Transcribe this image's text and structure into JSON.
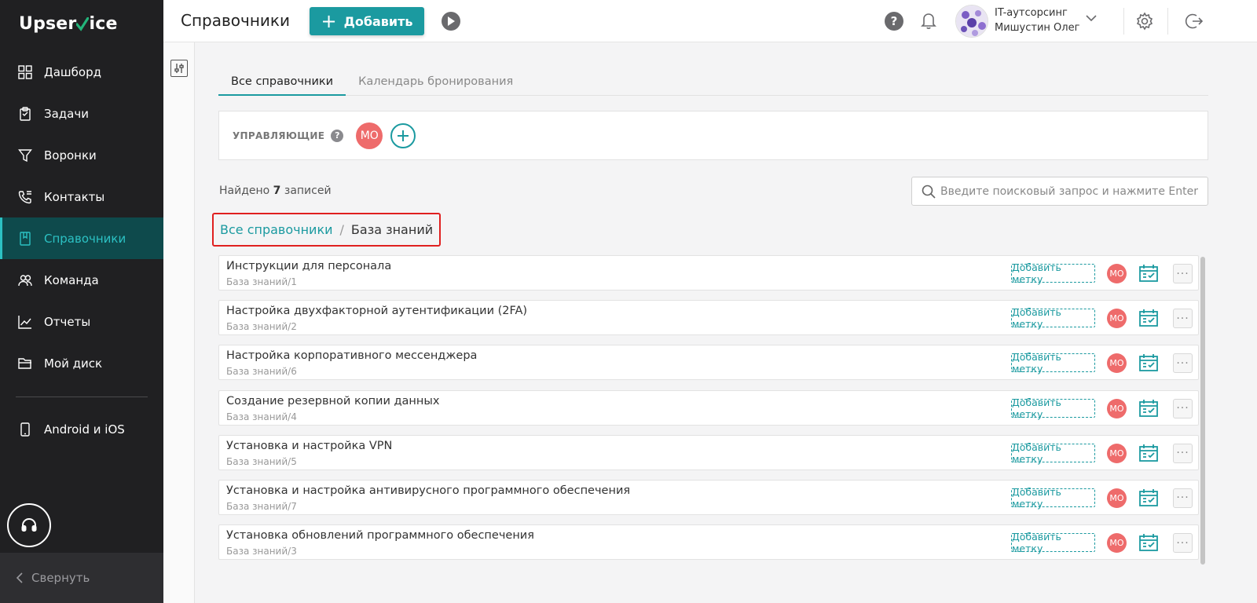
{
  "app": {
    "logo_text_a": "Upser",
    "logo_text_b": "ice",
    "accent_color": "#1b9aa0",
    "logo_check_color": "#23b47a"
  },
  "sidebar": {
    "items": [
      {
        "label": "Дашборд",
        "icon": "dashboard-grid-icon"
      },
      {
        "label": "Задачи",
        "icon": "tasks-clipboard-icon"
      },
      {
        "label": "Воронки",
        "icon": "funnel-icon"
      },
      {
        "label": "Контакты",
        "icon": "phone-contacts-icon"
      },
      {
        "label": "Справочники",
        "icon": "book-icon",
        "active": true
      },
      {
        "label": "Команда",
        "icon": "team-icon"
      },
      {
        "label": "Отчеты",
        "icon": "chart-line-icon"
      },
      {
        "label": "Мой диск",
        "icon": "folder-icon"
      }
    ],
    "android_ios": "Android и iOS",
    "collapse_label": "Свернуть"
  },
  "topbar": {
    "title": "Справочники",
    "add_label": "Добавить",
    "org_name": "IT-аутсорсинг",
    "user_name": "Мишустин Олег",
    "help_glyph": "?"
  },
  "tabs": [
    {
      "label": "Все справочники",
      "active": true
    },
    {
      "label": "Календарь бронирования",
      "active": false
    }
  ],
  "managers": {
    "label": "УПРАВЛЯЮЩИЕ",
    "avatar_initials": "МО",
    "help_glyph": "?"
  },
  "found": {
    "prefix": "Найдено",
    "count": "7",
    "suffix": "записей"
  },
  "search": {
    "placeholder": "Введите поисковый запрос и нажмите Enter",
    "value": ""
  },
  "breadcrumb": {
    "parent": "Все справочники",
    "separator": "/",
    "current": "База знаний"
  },
  "rows": [
    {
      "title": "Инструкции для персонала",
      "path": "База знаний/1",
      "tag_label": "Добавить метку",
      "avatar": "МО"
    },
    {
      "title": "Настройка двухфакторной аутентификации (2FA)",
      "path": "База знаний/2",
      "tag_label": "Добавить метку",
      "avatar": "МО"
    },
    {
      "title": "Настройка корпоративного мессенджера",
      "path": "База знаний/6",
      "tag_label": "Добавить метку",
      "avatar": "МО"
    },
    {
      "title": "Создание резервной копии данных",
      "path": "База знаний/4",
      "tag_label": "Добавить метку",
      "avatar": "МО"
    },
    {
      "title": "Установка и настройка VPN",
      "path": "База знаний/5",
      "tag_label": "Добавить метку",
      "avatar": "МО"
    },
    {
      "title": "Установка и настройка антивирусного программного обеспечения",
      "path": "База знаний/7",
      "tag_label": "Добавить метку",
      "avatar": "МО"
    },
    {
      "title": "Установка обновлений программного обеспечения",
      "path": "База знаний/3",
      "tag_label": "Добавить метку",
      "avatar": "МО"
    }
  ]
}
